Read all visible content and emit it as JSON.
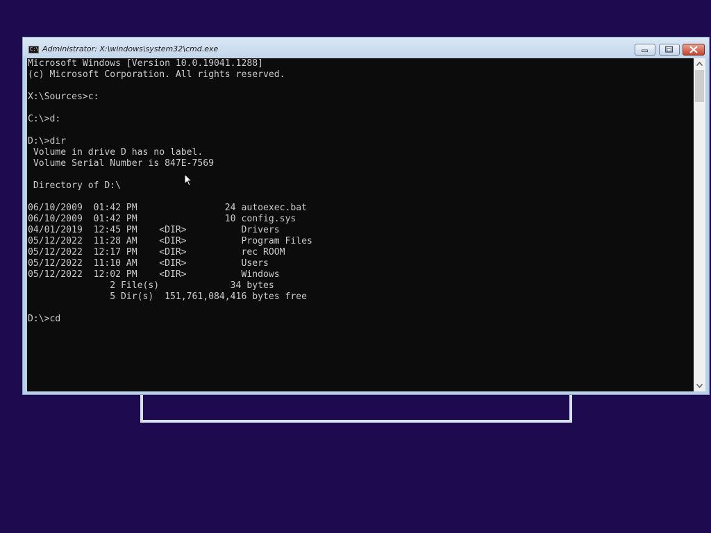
{
  "window": {
    "title": "Administrator: X:\\windows\\system32\\cmd.exe",
    "icon_label": "C:\\"
  },
  "console": {
    "lines": [
      "Microsoft Windows [Version 10.0.19041.1288]",
      "(c) Microsoft Corporation. All rights reserved.",
      "",
      "X:\\Sources>c:",
      "",
      "C:\\>d:",
      "",
      "D:\\>dir",
      " Volume in drive D has no label.",
      " Volume Serial Number is 847E-7569",
      "",
      " Directory of D:\\",
      "",
      "06/10/2009  01:42 PM                24 autoexec.bat",
      "06/10/2009  01:42 PM                10 config.sys",
      "04/01/2019  12:45 PM    <DIR>          Drivers",
      "05/12/2022  11:28 AM    <DIR>          Program Files",
      "05/12/2022  12:17 PM    <DIR>          rec ROOM",
      "05/12/2022  11:10 AM    <DIR>          Users",
      "05/12/2022  12:02 PM    <DIR>          Windows",
      "               2 File(s)             34 bytes",
      "               5 Dir(s)  151,761,084,416 bytes free",
      "",
      "D:\\>cd"
    ]
  },
  "icons": {
    "app": "cmd-icon",
    "minimize": "minimize-icon",
    "maximize": "maximize-icon",
    "close": "close-icon",
    "scroll_up": "scroll-up-arrow-icon",
    "scroll_down": "scroll-down-arrow-icon",
    "cursor": "mouse-pointer-icon"
  },
  "colors": {
    "desktop_background": "#1e0b4f",
    "console_background": "#0c0c0c",
    "console_text": "#cccccc",
    "close_button": "#c2452e"
  }
}
